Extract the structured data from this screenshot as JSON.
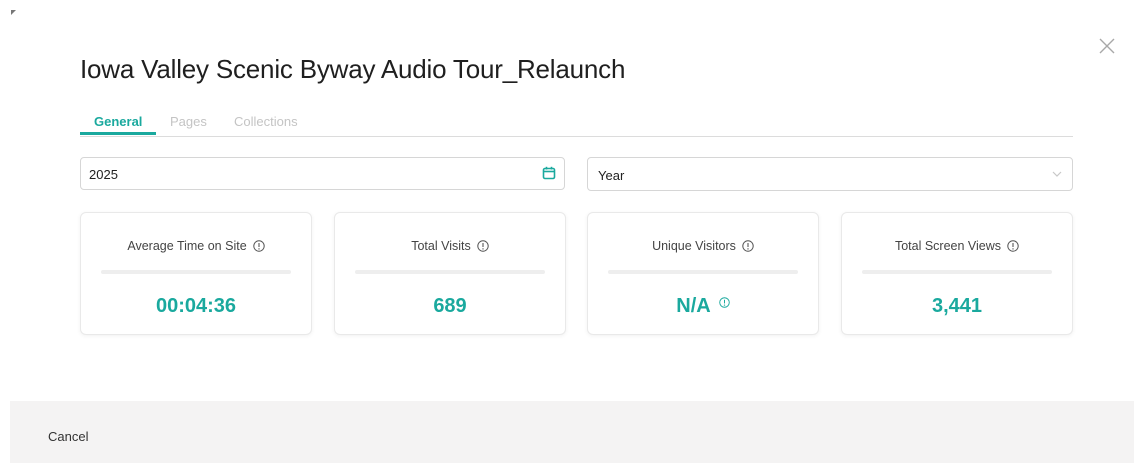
{
  "modal": {
    "title": "Iowa Valley Scenic Byway Audio Tour_Relaunch",
    "close_icon": "close-icon"
  },
  "tabs": [
    {
      "label": "General",
      "active": true
    },
    {
      "label": "Pages",
      "active": false
    },
    {
      "label": "Collections",
      "active": false
    }
  ],
  "filters": {
    "date_value": "2025",
    "date_icon": "calendar-icon",
    "period_value": "Year",
    "period_icon": "chevron-down-icon"
  },
  "stats": [
    {
      "label": "Average Time on Site",
      "value": "00:04:36"
    },
    {
      "label": "Total Visits",
      "value": "689"
    },
    {
      "label": "Unique Visitors",
      "value": "N/A"
    },
    {
      "label": "Total Screen Views",
      "value": "3,441"
    }
  ],
  "footer": {
    "cancel_label": "Cancel"
  },
  "colors": {
    "accent": "#1aa99e",
    "footer_bg": "#f4f3f3"
  }
}
